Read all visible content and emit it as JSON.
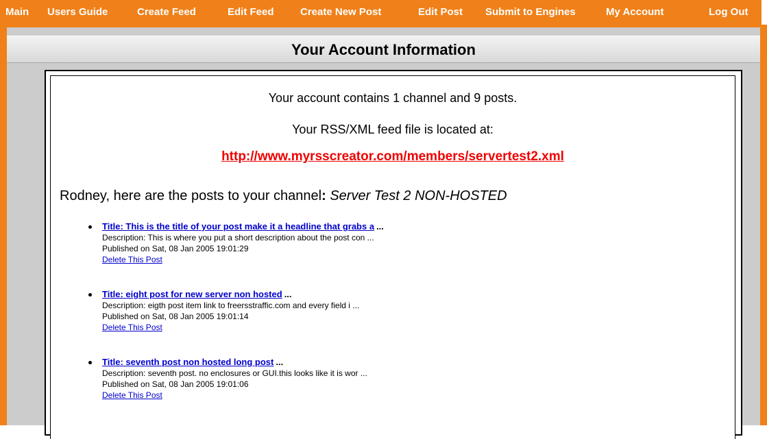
{
  "nav": {
    "items": [
      {
        "label": "Main"
      },
      {
        "label": "Users Guide"
      },
      {
        "label": "Create Feed"
      },
      {
        "label": "Edit Feed"
      },
      {
        "label": "Create New Post"
      },
      {
        "label": "Edit Post"
      },
      {
        "label": "Submit to Engines"
      },
      {
        "label": "My Account"
      },
      {
        "label": "Log Out"
      }
    ]
  },
  "header": {
    "title": "Your Account Information"
  },
  "account": {
    "summary": "Your account contains 1 channel and 9 posts.",
    "feed_intro": "Your RSS/XML feed file is located at:",
    "feed_url": "http://www.myrsscreator.com/members/servertest2.xml",
    "channel_intro": "Rodney, here are the posts to your channel",
    "channel_colon": ":",
    "channel_name": "Server Test 2 NON-HOSTED"
  },
  "posts": [
    {
      "title": "Title: This is the title of your post make it a headline that grabs a",
      "ellipsis": "...",
      "description": "Description: This is where you put a short description about the post con ...",
      "published": "Published on Sat, 08 Jan 2005 19:01:29",
      "delete_label": "Delete This Post"
    },
    {
      "title": "Title: eight post for new server non hosted",
      "ellipsis": "...",
      "description": "Description: eigth post item link to freersstraffic.com and every field i ...",
      "published": "Published on Sat, 08 Jan 2005 19:01:14",
      "delete_label": "Delete This Post"
    },
    {
      "title": "Title: seventh post non hosted long post",
      "ellipsis": "...",
      "description": "Description: seventh post. no enclosures or GUI.this looks like it is wor ...",
      "published": "Published on Sat, 08 Jan 2005 19:01:06",
      "delete_label": "Delete This Post"
    }
  ],
  "colors": {
    "nav_orange": "#f08019",
    "link_blue": "#0000cc",
    "feed_url_red": "#ee0000",
    "frame_gray": "#cccccc"
  }
}
